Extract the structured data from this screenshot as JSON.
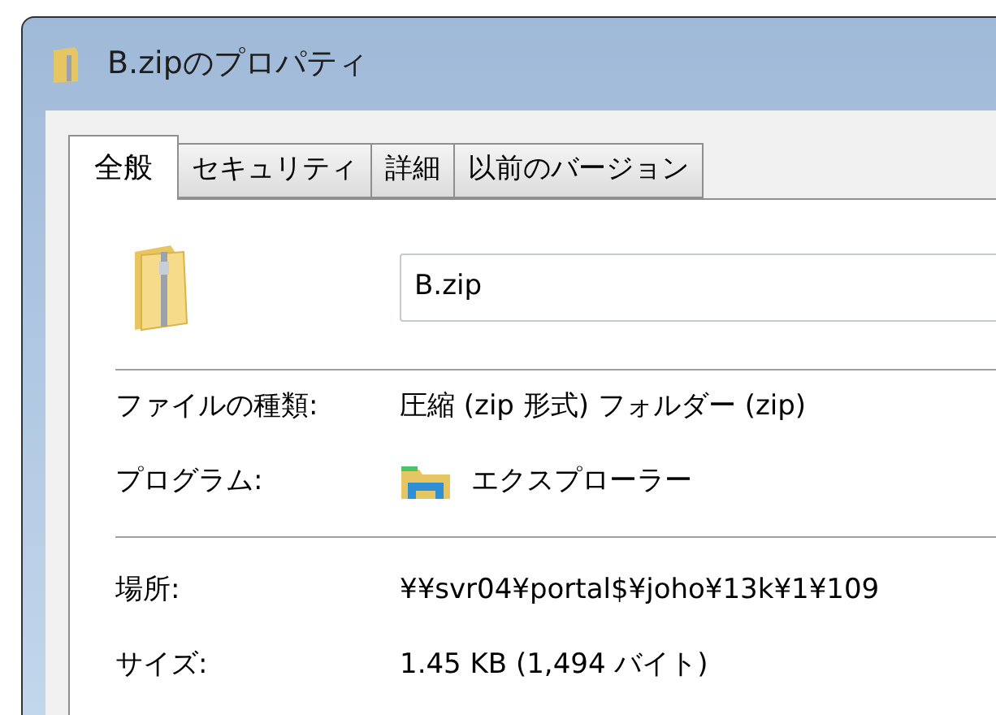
{
  "window": {
    "title": "B.zipのプロパティ"
  },
  "tabs": [
    {
      "label": "全般",
      "selected": true
    },
    {
      "label": "セキュリティ",
      "selected": false
    },
    {
      "label": "詳細",
      "selected": false
    },
    {
      "label": "以前のバージョン",
      "selected": false
    }
  ],
  "name_field": {
    "value": "B.zip"
  },
  "properties": [
    {
      "label": "ファイルの種類:",
      "value": "圧縮 (zip 形式) フォルダー (zip)"
    },
    {
      "label": "プログラム:",
      "value": "エクスプローラー",
      "kind": "app"
    },
    {
      "kind": "divider"
    },
    {
      "label": "場所:",
      "value": "¥¥svr04¥portal$¥joho¥13k¥1¥109"
    },
    {
      "label": "サイズ:",
      "value": "1.45 KB (1,494 バイト)"
    }
  ]
}
